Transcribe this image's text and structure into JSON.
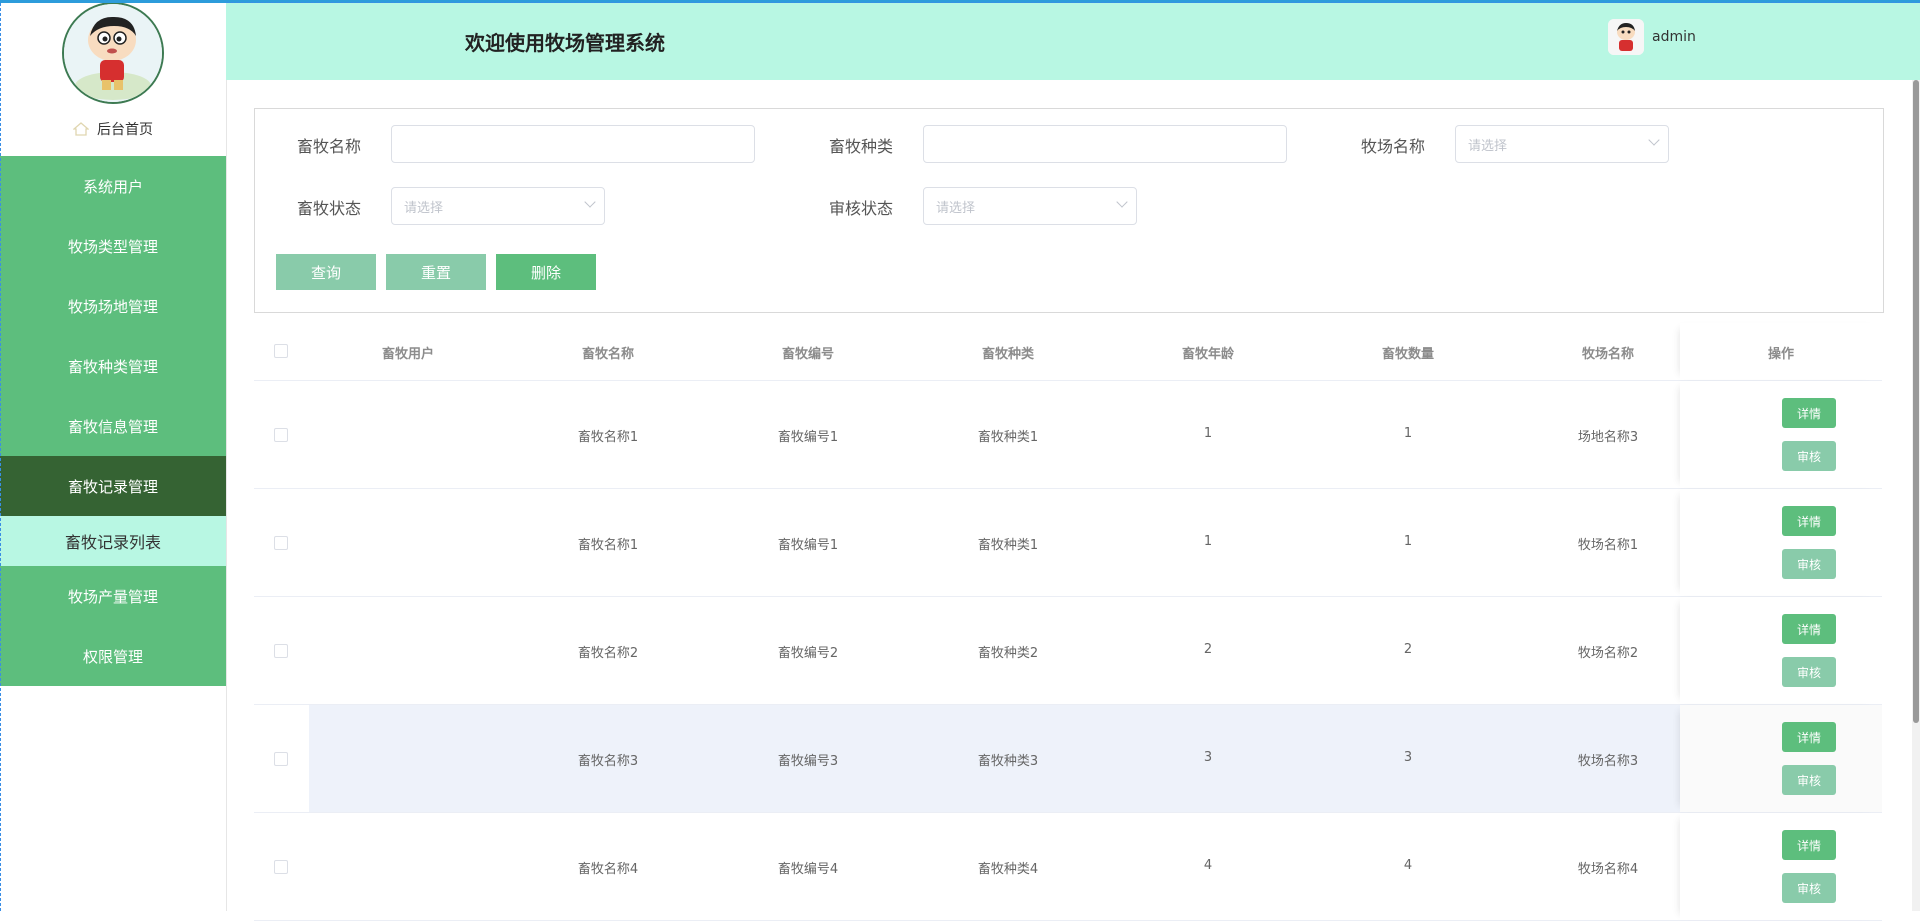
{
  "header": {
    "title": "欢迎使用牧场管理系统",
    "username": "admin"
  },
  "sidebar": {
    "home_label": "后台首页",
    "items": [
      {
        "label": "系统用户"
      },
      {
        "label": "牧场类型管理"
      },
      {
        "label": "牧场场地管理"
      },
      {
        "label": "畜牧种类管理"
      },
      {
        "label": "畜牧信息管理"
      },
      {
        "label": "畜牧记录管理"
      }
    ],
    "sub_item": "畜牧记录列表",
    "items_after": [
      {
        "label": "牧场产量管理"
      },
      {
        "label": "权限管理"
      }
    ]
  },
  "search": {
    "livestock_name_label": "畜牧名称",
    "livestock_type_label": "畜牧种类",
    "ranch_name_label": "牧场名称",
    "ranch_name_placeholder": "请选择",
    "livestock_status_label": "畜牧状态",
    "livestock_status_placeholder": "请选择",
    "review_status_label": "审核状态",
    "review_status_placeholder": "请选择",
    "query_label": "查询",
    "reset_label": "重置",
    "delete_label": "删除"
  },
  "table": {
    "headers": [
      "畜牧用户",
      "畜牧名称",
      "畜牧编号",
      "畜牧种类",
      "畜牧年龄",
      "畜牧数量",
      "牧场名称",
      "操作"
    ],
    "detail_label": "详情",
    "review_label": "审核",
    "rows": [
      {
        "user": "",
        "name": "畜牧名称1",
        "code": "畜牧编号1",
        "type": "畜牧种类1",
        "age": "1",
        "count": "1",
        "ranch": "场地名称3"
      },
      {
        "user": "",
        "name": "畜牧名称1",
        "code": "畜牧编号1",
        "type": "畜牧种类1",
        "age": "1",
        "count": "1",
        "ranch": "牧场名称1"
      },
      {
        "user": "",
        "name": "畜牧名称2",
        "code": "畜牧编号2",
        "type": "畜牧种类2",
        "age": "2",
        "count": "2",
        "ranch": "牧场名称2"
      },
      {
        "user": "",
        "name": "畜牧名称3",
        "code": "畜牧编号3",
        "type": "畜牧种类3",
        "age": "3",
        "count": "3",
        "ranch": "牧场名称3"
      },
      {
        "user": "",
        "name": "畜牧名称4",
        "code": "畜牧编号4",
        "type": "畜牧种类4",
        "age": "4",
        "count": "4",
        "ranch": "牧场名称4"
      }
    ]
  },
  "colors": {
    "primary": "#5dbe7d",
    "primary_light": "#89cbaa",
    "header_bg": "#b8f7e3",
    "menu_active": "#356333"
  }
}
